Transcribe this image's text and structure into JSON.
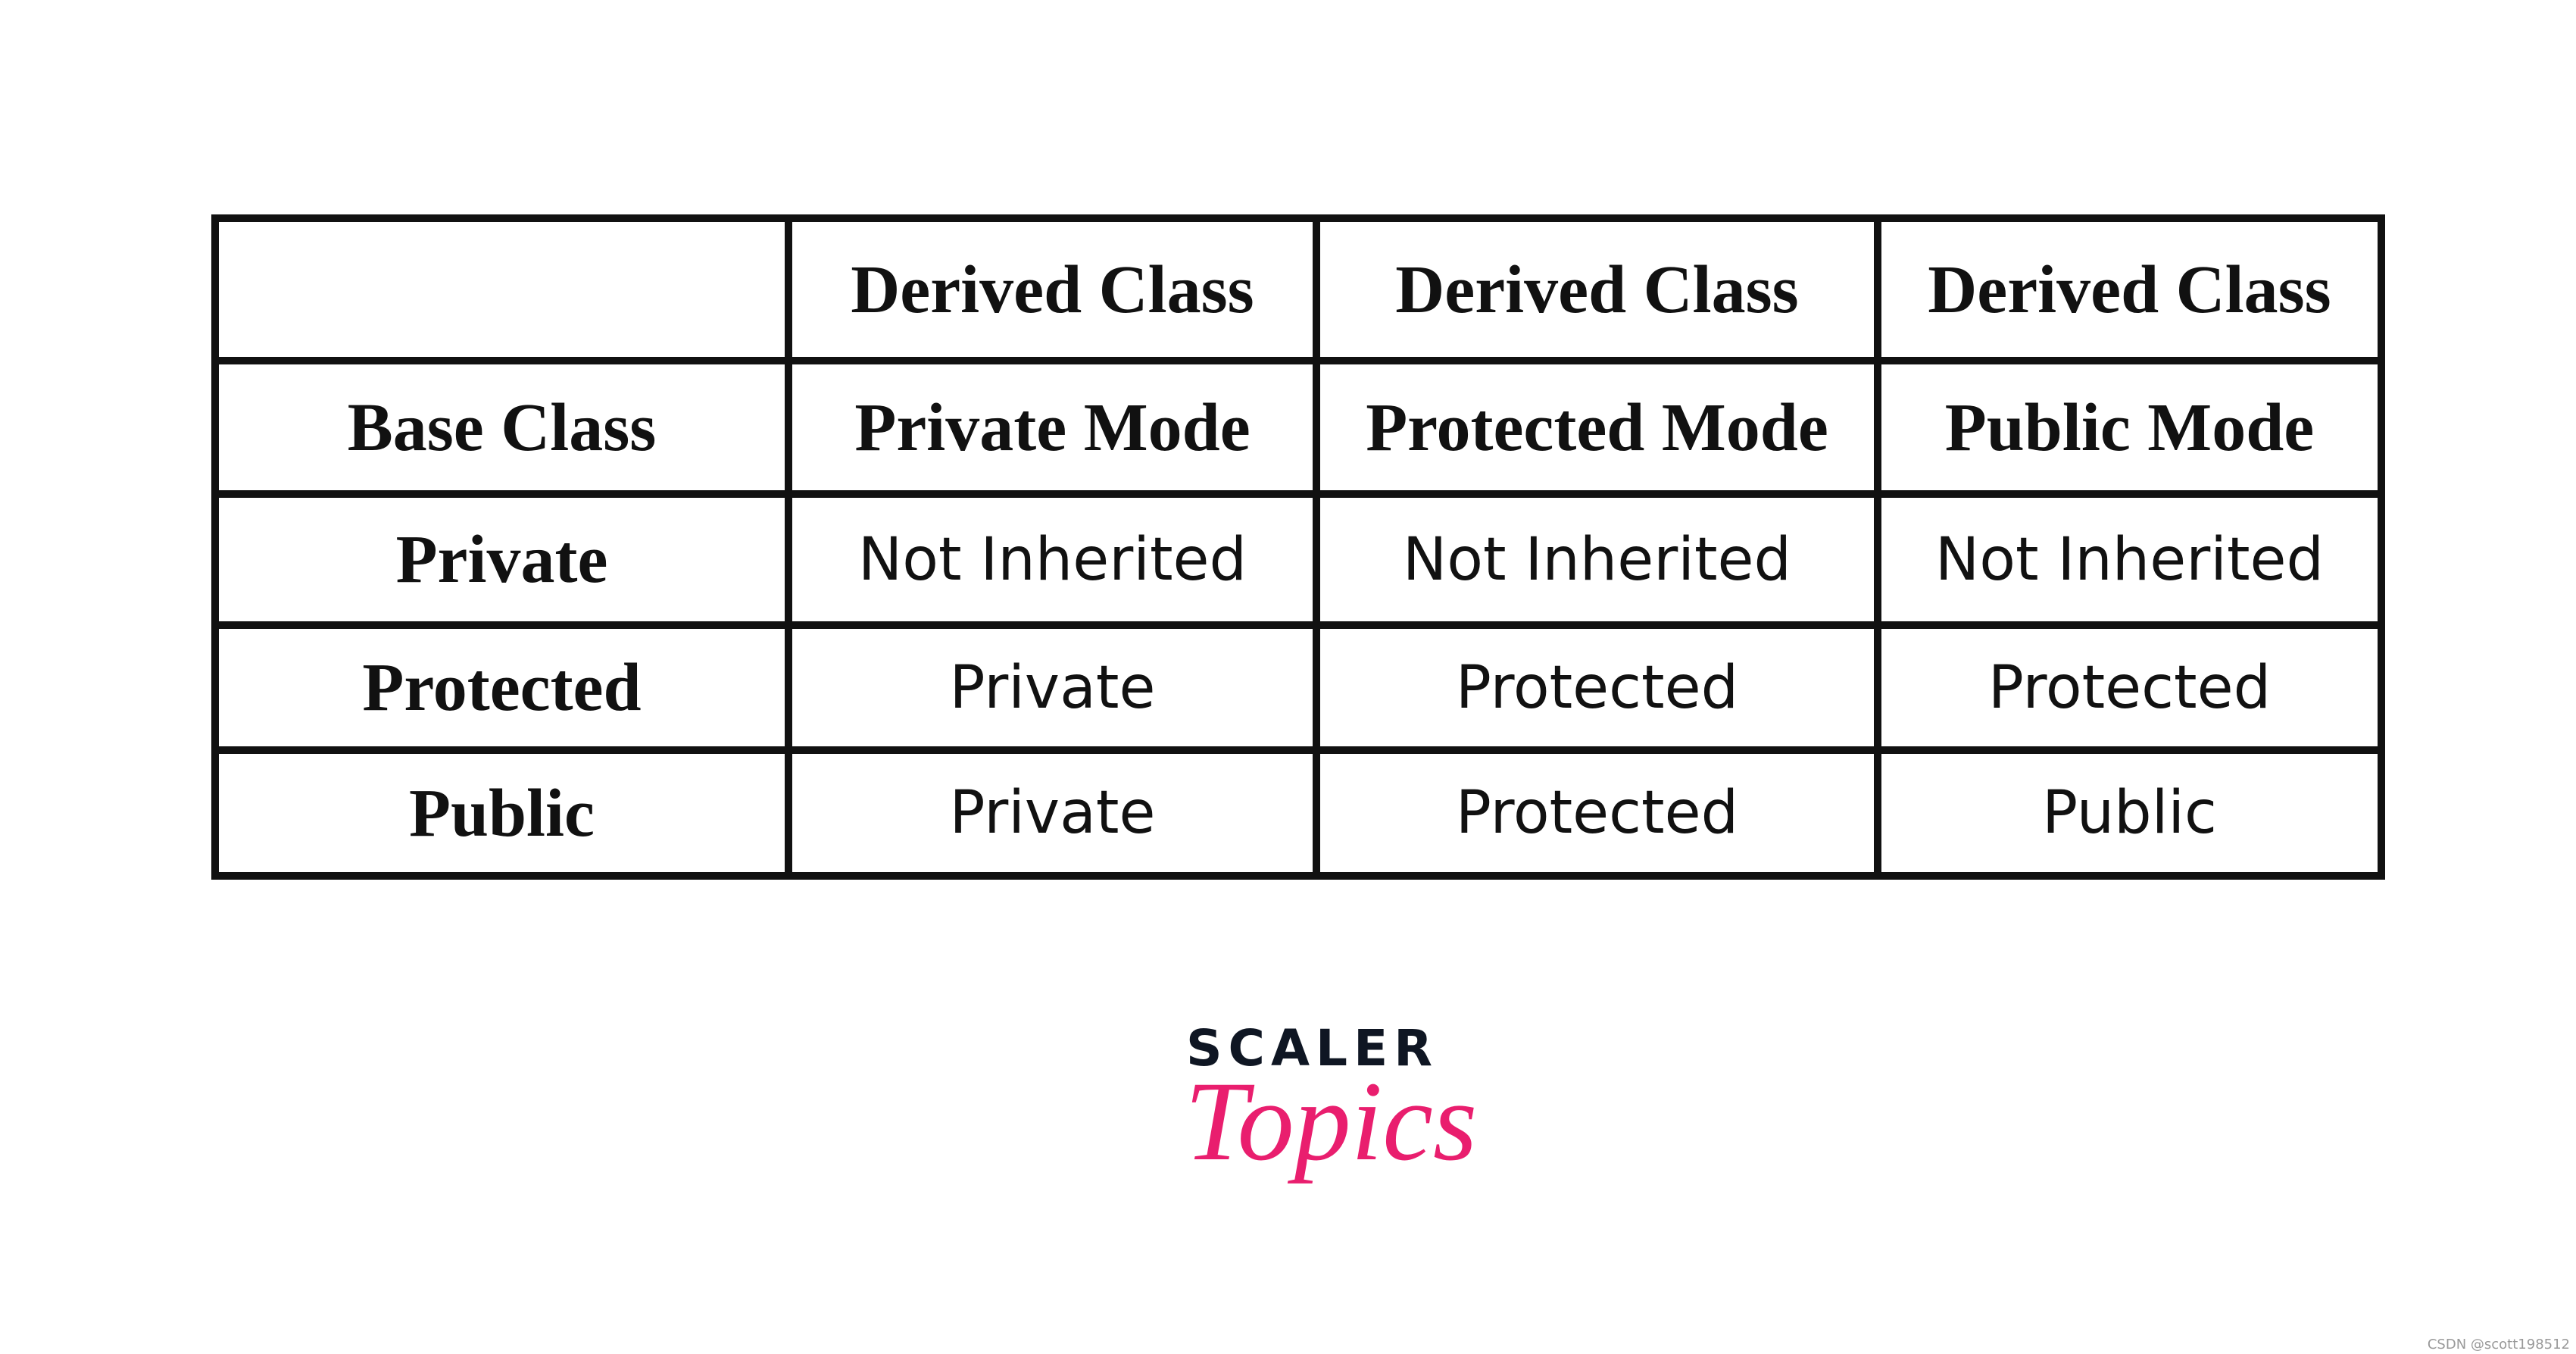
{
  "table": {
    "header_row1": [
      "",
      "Derived Class",
      "Derived Class",
      "Derived Class"
    ],
    "header_row2": [
      "Base Class",
      "Private Mode",
      "Protected Mode",
      "Public Mode"
    ],
    "rows": [
      {
        "base": "Private",
        "cells": [
          "Not Inherited",
          "Not Inherited",
          "Not Inherited"
        ]
      },
      {
        "base": "Protected",
        "cells": [
          "Private",
          "Protected",
          "Protected"
        ]
      },
      {
        "base": "Public",
        "cells": [
          "Private",
          "Protected",
          "Public"
        ]
      }
    ]
  },
  "logo": {
    "line1": "SCALER",
    "line2": "Topics",
    "colors": {
      "dark": "#0f1623",
      "accent": "#e91e6e"
    }
  },
  "watermark": "CSDN @scott198512"
}
